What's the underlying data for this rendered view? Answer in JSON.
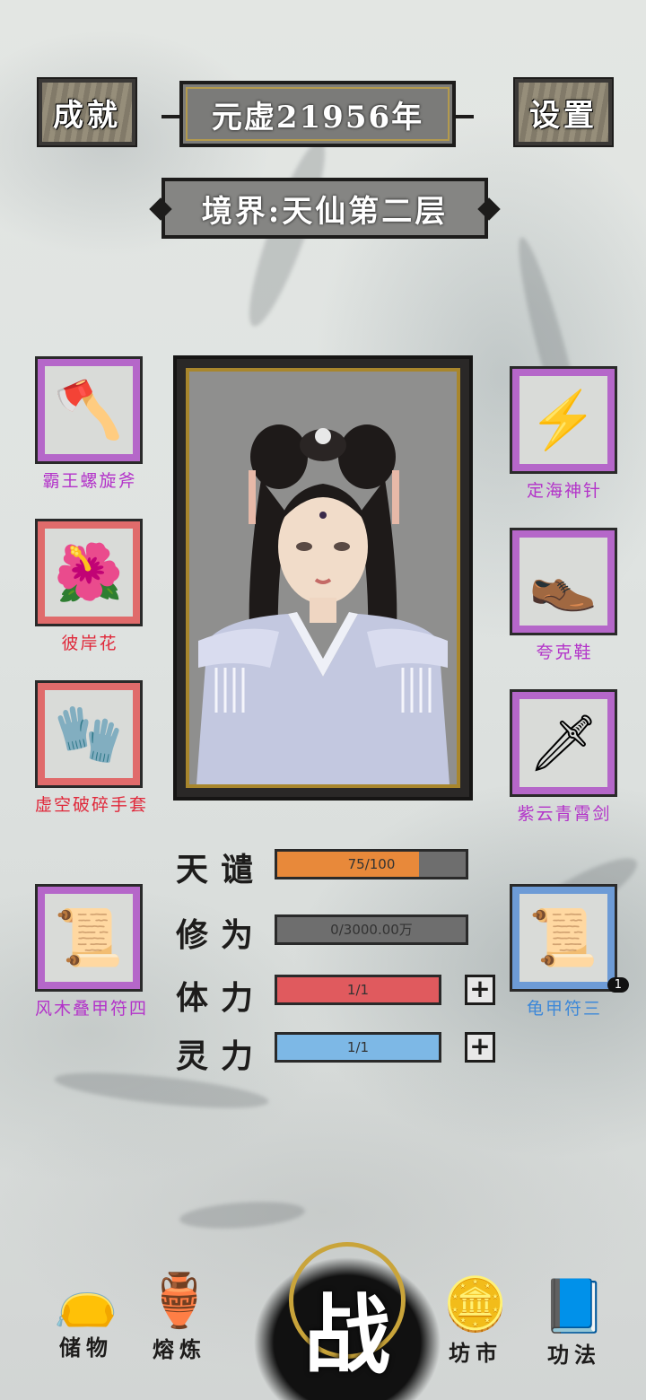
{
  "header": {
    "achievements_label": "成就",
    "settings_label": "设置",
    "year": "元虚21956年",
    "realm": "境界:天仙第二层"
  },
  "equipment": {
    "left": [
      {
        "name": "霸王螺旋斧",
        "rarity": "purple",
        "icon": "axe-icon",
        "glyph": "🪓"
      },
      {
        "name": "彼岸花",
        "rarity": "red",
        "icon": "spider-lily-icon",
        "glyph": "🌺"
      },
      {
        "name": "虚空破碎手套",
        "rarity": "red",
        "icon": "gauntlet-icon",
        "glyph": "🧤"
      },
      {
        "name": "风木叠甲符四",
        "rarity": "purple",
        "icon": "talisman-icon",
        "glyph": "📜"
      }
    ],
    "right": [
      {
        "name": "定海神针",
        "rarity": "purple",
        "icon": "lightning-needle-icon",
        "glyph": "⚡"
      },
      {
        "name": "夸克鞋",
        "rarity": "purple",
        "icon": "boots-icon",
        "glyph": "👞"
      },
      {
        "name": "紫云青霄剑",
        "rarity": "purple",
        "icon": "sword-icon",
        "glyph": "🗡"
      },
      {
        "name": "龟甲符三",
        "rarity": "blue",
        "icon": "talisman-icon",
        "glyph": "📜",
        "count": "1"
      }
    ]
  },
  "stats": {
    "tianqian": {
      "label": "天谴",
      "text": "75/100",
      "fraction": 0.75,
      "color": "#e8893a"
    },
    "xiuwei": {
      "label": "修为",
      "text": "0/3000.00万",
      "fraction": 0,
      "color": "#6e6e6e"
    },
    "tili": {
      "label": "体力",
      "text": "1/1",
      "fraction": 1,
      "color": "#e05a5e"
    },
    "lingli": {
      "label": "灵力",
      "text": "1/1",
      "fraction": 1,
      "color": "#7db8e6"
    },
    "plus_symbol": "+"
  },
  "nav": {
    "storage": {
      "label": "储物",
      "icon": "pouch-icon",
      "glyph": "👝"
    },
    "refine": {
      "label": "熔炼",
      "icon": "cauldron-icon",
      "glyph": "🏺"
    },
    "battle": {
      "label": "战",
      "icon": "battle-icon"
    },
    "market": {
      "label": "坊市",
      "icon": "coins-icon",
      "glyph": "🪙"
    },
    "techniques": {
      "label": "功法",
      "icon": "book-icon",
      "glyph": "📘"
    }
  }
}
